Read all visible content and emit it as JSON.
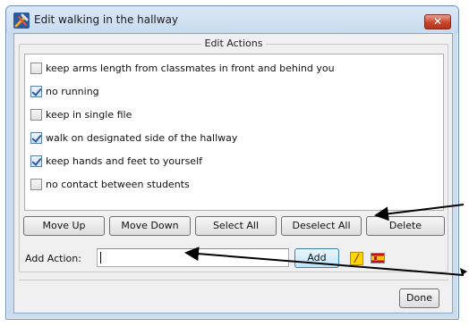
{
  "window": {
    "title": "Edit walking in the hallway",
    "close_glyph": "✕"
  },
  "group": {
    "title": "Edit Actions"
  },
  "actions": [
    {
      "label": "keep arms length from classmates in front and behind you",
      "checked": false
    },
    {
      "label": "no running",
      "checked": true
    },
    {
      "label": "keep in single file",
      "checked": false
    },
    {
      "label": "walk on designated side of the hallway",
      "checked": true
    },
    {
      "label": "keep hands and feet to yourself",
      "checked": true
    },
    {
      "label": "no contact between students",
      "checked": false
    }
  ],
  "buttons": {
    "move_up": "Move Up",
    "move_down": "Move Down",
    "select_all": "Select All",
    "deselect_all": "Deselect All",
    "delete": "Delete",
    "add": "Add",
    "done": "Done"
  },
  "add_action": {
    "label": "Add Action:",
    "value": ""
  },
  "icons": {
    "app": "hammer-wrench-icon",
    "lightning": "lightning-icon",
    "language": "spain-flag-icon"
  },
  "colors": {
    "close_button": "#c8442a",
    "highlight_button": "#bee6fd",
    "check": "#2b5a9a"
  }
}
